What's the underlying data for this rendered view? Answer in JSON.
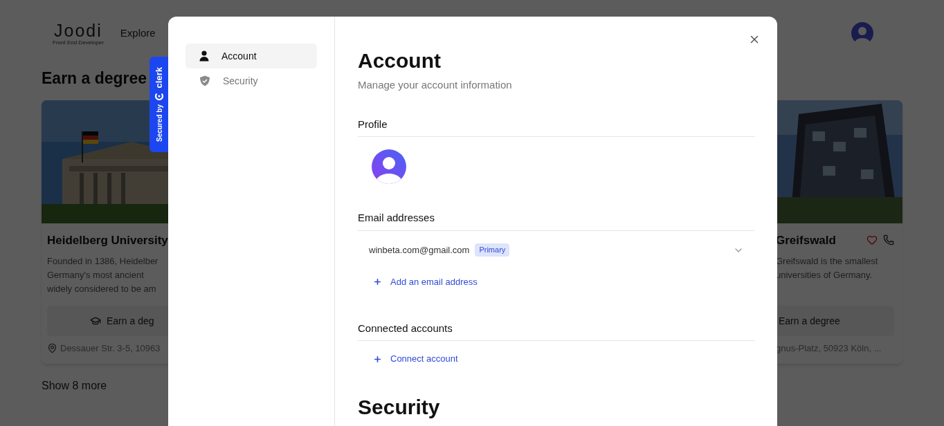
{
  "header": {
    "logo": "Joodi",
    "logo_tagline": "Front End Developer",
    "nav": [
      "Explore"
    ]
  },
  "section_title": "Earn a degree",
  "cards": [
    {
      "kind": "left",
      "title": "Heidelberg University",
      "description_lines": [
        "Founded in 1386, Heidelber",
        "Germany's most ancient",
        "widely considered to be am"
      ],
      "button": "Earn a deg",
      "address": "Dessauer Str. 3-5, 10963"
    },
    {
      "kind": "right",
      "title": "Greifswald",
      "description_lines": [
        "Greifswald is the smallest",
        "universities of Germany."
      ],
      "button": "Earn a degree",
      "address": "gnus-Platz, 50923 Köln, ...",
      "favorite": false
    }
  ],
  "show_more": "Show 8 more",
  "badge": {
    "prefix": "Secured by",
    "brand": "clerk"
  },
  "modal": {
    "nav": [
      {
        "label": "Account",
        "selected": true
      },
      {
        "label": "Security",
        "selected": false
      }
    ],
    "title": "Account",
    "subtitle": "Manage your account information",
    "sections": [
      {
        "kind": "profile",
        "title": "Profile"
      },
      {
        "kind": "emails",
        "title": "Email addresses",
        "emails": [
          {
            "address": "winbeta.com@gmail.com",
            "tag": "Primary"
          }
        ],
        "action": "Add an email address"
      },
      {
        "kind": "connected",
        "title": "Connected accounts",
        "action": "Connect account"
      }
    ],
    "next_title": "Security"
  }
}
